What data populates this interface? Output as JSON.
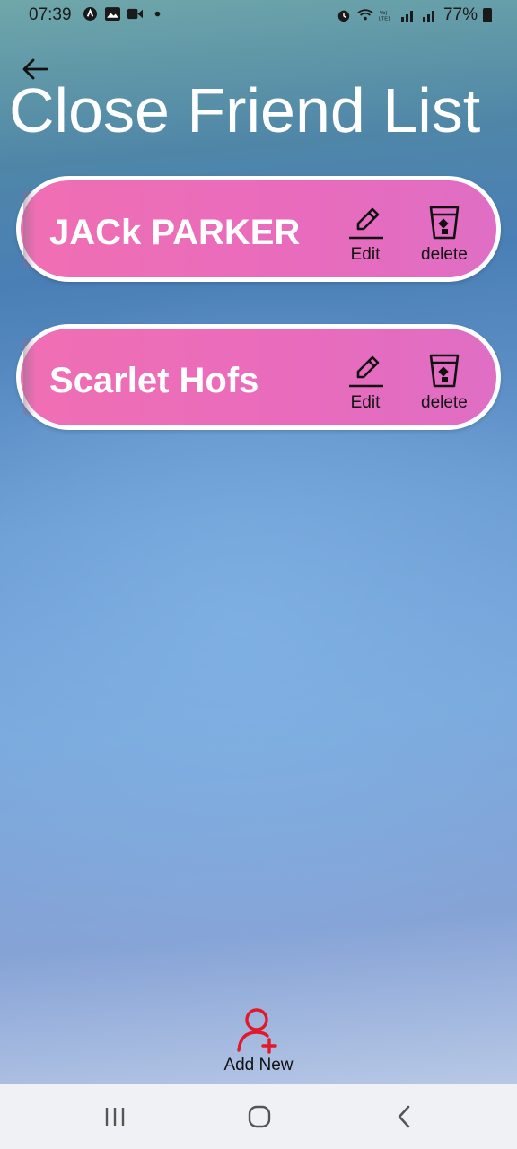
{
  "status_bar": {
    "time": "07:39",
    "battery": "77%",
    "left_icons": [
      "nav-app-icon",
      "image-icon",
      "video-icon",
      "dot-icon"
    ],
    "right_icons": [
      "alarm-icon",
      "wifi-icon",
      "volte-icon",
      "signal-icon",
      "signal-icon",
      "battery-icon"
    ]
  },
  "header": {
    "title": "Close Friend List"
  },
  "friends": [
    {
      "name": "JACk PARKER",
      "edit_label": "Edit",
      "delete_label": "delete"
    },
    {
      "name": "Scarlet Hofs",
      "edit_label": "Edit",
      "delete_label": "delete"
    }
  ],
  "add_new": {
    "label": "Add New",
    "icon_color": "#e0192b"
  },
  "colors": {
    "card_pink": "#ee6db6",
    "card_border": "#ffffff",
    "title_text": "#ffffff"
  },
  "nav_bar": {
    "buttons": [
      "recent-apps-icon",
      "home-icon",
      "back-icon"
    ]
  }
}
